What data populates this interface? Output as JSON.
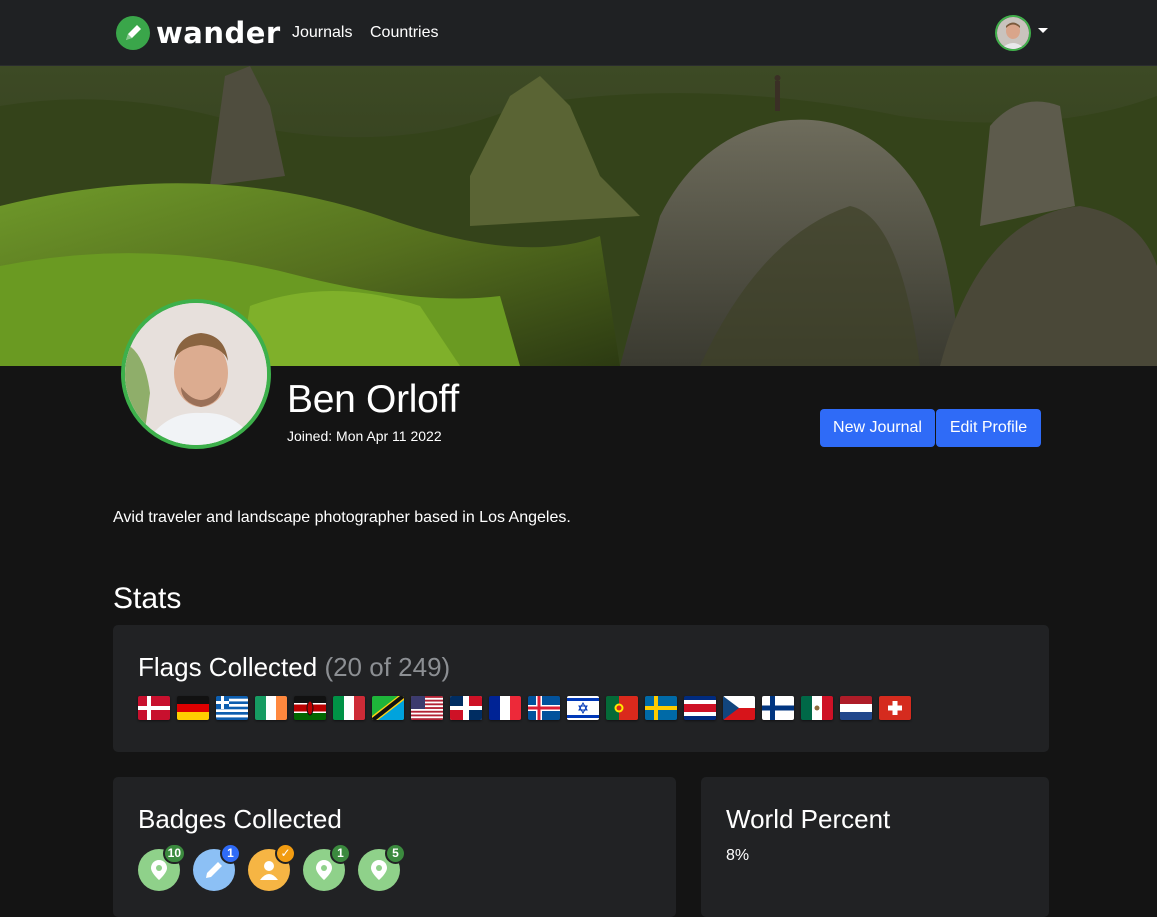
{
  "nav": {
    "brand": "wander",
    "links": [
      "Journals",
      "Countries"
    ]
  },
  "profile": {
    "name": "Ben Orloff",
    "joined": "Joined: Mon Apr 11 2022",
    "bio": "Avid traveler and landscape photographer based in Los Angeles.",
    "buttons": {
      "new_journal": "New Journal",
      "edit_profile": "Edit Profile"
    }
  },
  "stats": {
    "heading": "Stats",
    "flags": {
      "title": "Flags Collected",
      "count": "(20 of 249)",
      "countries": [
        "Denmark",
        "Germany",
        "Greece",
        "Ireland",
        "Kenya",
        "Italy",
        "Tanzania",
        "United States",
        "Dominican Republic",
        "France",
        "Iceland",
        "Israel",
        "Portugal",
        "Sweden",
        "Costa Rica",
        "Czech Republic",
        "Finland",
        "Mexico",
        "Netherlands",
        "Switzerland"
      ]
    },
    "badges": {
      "title": "Badges Collected",
      "items": [
        {
          "icon": "map-pin-icon",
          "count": "10",
          "color": "#8fd18a",
          "count_color": "#3b8a3e"
        },
        {
          "icon": "pencil-icon",
          "count": "1",
          "color": "#8cc0f5",
          "count_color": "#2f6bf7"
        },
        {
          "icon": "person-icon",
          "count": "✓",
          "color": "#f6b544",
          "count_color": "#f29c11"
        },
        {
          "icon": "map-pin-icon",
          "count": "1",
          "color": "#8fd18a",
          "count_color": "#3b8a3e"
        },
        {
          "icon": "map-pin-icon",
          "count": "5",
          "color": "#8fd18a",
          "count_color": "#3b8a3e"
        }
      ]
    },
    "world": {
      "title": "World Percent",
      "value": "8%"
    }
  },
  "colors": {
    "accent": "#2f6bf7",
    "brand_green": "#3aa64a",
    "card_bg": "#212224",
    "page_bg": "#141414"
  }
}
